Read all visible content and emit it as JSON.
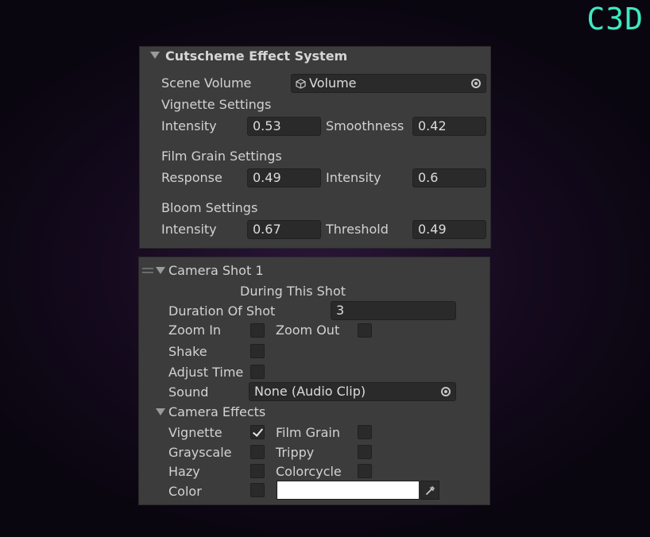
{
  "logo": "C3D",
  "effect_system": {
    "title": "Cutscheme Effect System",
    "scene_volume_label": "Scene Volume",
    "scene_volume_value": "Volume",
    "vignette": {
      "header": "Vignette Settings",
      "intensity_label": "Intensity",
      "intensity": "0.53",
      "smoothness_label": "Smoothness",
      "smoothness": "0.42"
    },
    "film_grain": {
      "header": "Film Grain Settings",
      "response_label": "Response",
      "response": "0.49",
      "intensity_label": "Intensity",
      "intensity": "0.6"
    },
    "bloom": {
      "header": "Bloom Settings",
      "intensity_label": "Intensity",
      "intensity": "0.67",
      "threshold_label": "Threshold",
      "threshold": "0.49"
    }
  },
  "camera_shot": {
    "title": "Camera Shot 1",
    "during_label": "During This Shot",
    "duration_label": "Duration Of Shot",
    "duration_value": "3",
    "zoom_in_label": "Zoom In",
    "zoom_in_checked": false,
    "zoom_out_label": "Zoom Out",
    "zoom_out_checked": false,
    "shake_label": "Shake",
    "shake_checked": false,
    "adjust_time_label": "Adjust Time",
    "adjust_time_checked": false,
    "sound_label": "Sound",
    "sound_value": "None (Audio Clip)",
    "effects_header": "Camera Effects",
    "vignette_label": "Vignette",
    "vignette_checked": true,
    "film_grain_label": "Film Grain",
    "film_grain_checked": false,
    "grayscale_label": "Grayscale",
    "grayscale_checked": false,
    "trippy_label": "Trippy",
    "trippy_checked": false,
    "hazy_label": "Hazy",
    "hazy_checked": false,
    "colorcycle_label": "Colorcycle",
    "colorcycle_checked": false,
    "color_label": "Color",
    "color_checked": false,
    "color_value": "#FFFFFF"
  }
}
